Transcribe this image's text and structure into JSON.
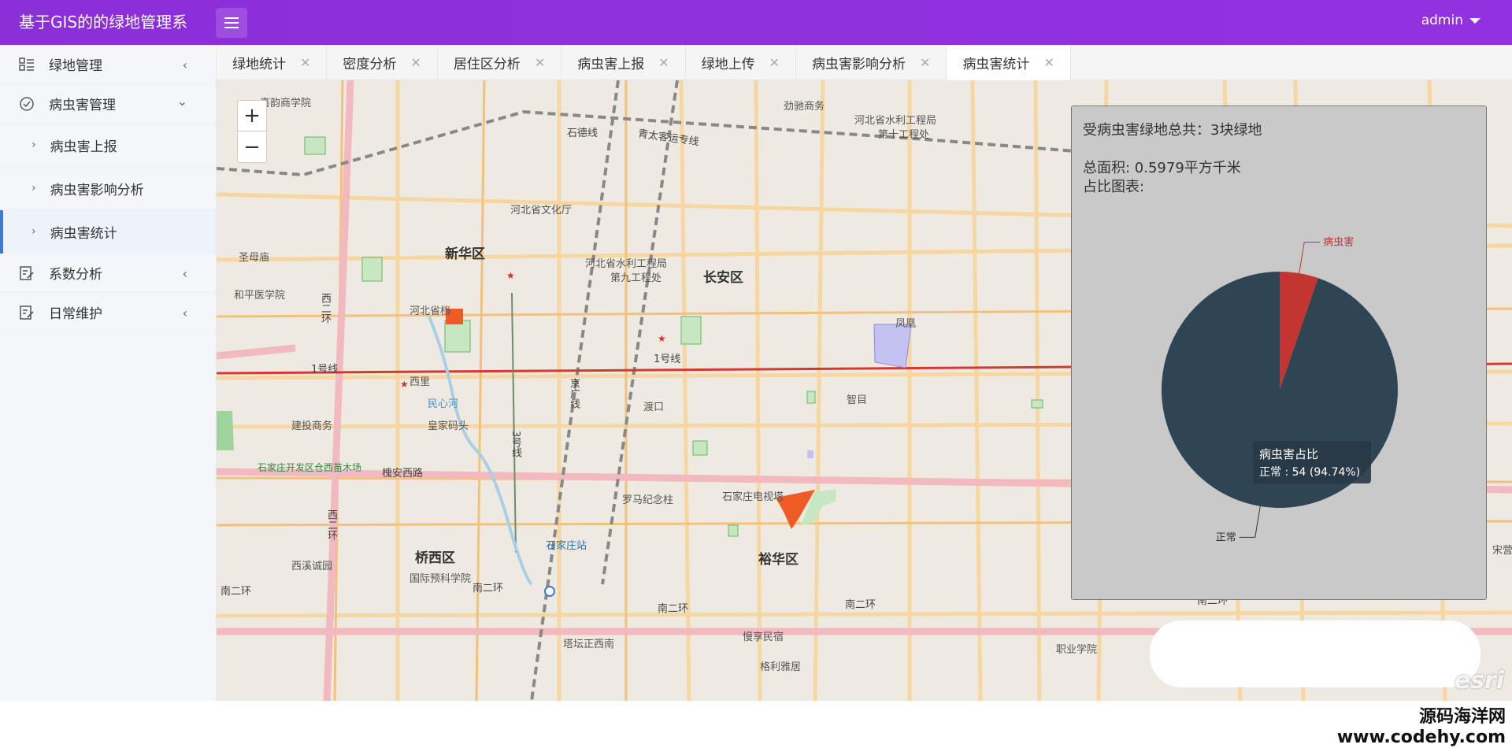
{
  "header": {
    "app_title": "基于GIS的的绿地管理系",
    "user": "admin"
  },
  "sidebar": {
    "items": [
      {
        "label": "绿地管理",
        "icon": "list-icon"
      },
      {
        "label": "病虫害管理",
        "icon": "check-circle-icon"
      },
      {
        "label": "病虫害上报",
        "icon": "chevron-right-icon"
      },
      {
        "label": "病虫害影响分析",
        "icon": "chevron-right-icon"
      },
      {
        "label": "病虫害统计",
        "icon": "chevron-right-icon"
      },
      {
        "label": "系数分析",
        "icon": "edit-doc-icon"
      },
      {
        "label": "日常维护",
        "icon": "edit-doc-icon"
      }
    ]
  },
  "tabs": [
    {
      "label": "绿地统计"
    },
    {
      "label": "密度分析"
    },
    {
      "label": "居住区分析"
    },
    {
      "label": "病虫害上报"
    },
    {
      "label": "绿地上传"
    },
    {
      "label": "病虫害影响分析"
    },
    {
      "label": "病虫害统计",
      "active": true
    }
  ],
  "map": {
    "labels": {
      "xijiao": "喜韵商学院",
      "shide": "石德线",
      "qingtai": "青太客运专线",
      "jingchi": "劲驰商务",
      "hbwater": "河北省水利工程局",
      "hbwater10": "第十工程处",
      "hbculture": "河北省文化厅",
      "xinhua": "新华区",
      "hbwater9a": "河北省水利工程局",
      "hbwater9b": "第九工程处",
      "changan": "长安区",
      "shengyou": "圣母庙",
      "heping": "和平医学院",
      "erhuan_w": "西二环",
      "hebei": "河北省档",
      "line1a": "1号线",
      "line1b": "1号线",
      "xili": "西里",
      "minxin": "民心河",
      "jingguang": "京广线",
      "duko": "渡口",
      "zhiji": "智目",
      "jianshe": "建投商务",
      "huangjia": "皇家码头",
      "sjz_dev": "石家庄开发区仓西苗木场",
      "huaian": "槐安西路",
      "line3": "3号线",
      "luoma": "罗马纪念柱",
      "sjztv": "石家庄电视塔",
      "erhuan_w2": "西二环",
      "sjz_station": "石家庄站",
      "qiaoxi": "桥西区",
      "xixi": "西溪诚园",
      "yuhua": "裕华区",
      "guoji": "国际预科学院",
      "nanerhuan1": "南二环",
      "nanerhuan2": "南二环",
      "nanerhuan3": "南二环",
      "nanerhuan4": "南二环",
      "nanerhuan5": "南二环",
      "taqiao": "塔坛正西南",
      "yimin": "慢享民宿",
      "gelin": "格利雅居",
      "zhiye": "职业学院",
      "song": "宋营",
      "feng": "凤凰",
      "esri": "esri"
    }
  },
  "stats": {
    "total_line": "受病虫害绿地总共：3块绿地",
    "area_line": "总面积: 0.5979平方千米",
    "chart_line": "占比图表:"
  },
  "chart_data": {
    "type": "pie",
    "title": "",
    "series": [
      {
        "name": "病虫害",
        "value": 3,
        "color": "#c23531"
      },
      {
        "name": "正常",
        "value": 54,
        "color": "#2f4554"
      }
    ],
    "tooltip": {
      "title": "病虫害占比",
      "line": "正常 : 54 (94.74%)"
    }
  },
  "watermark": {
    "line1": "源码海洋网",
    "line2": "www.codehy.com"
  }
}
